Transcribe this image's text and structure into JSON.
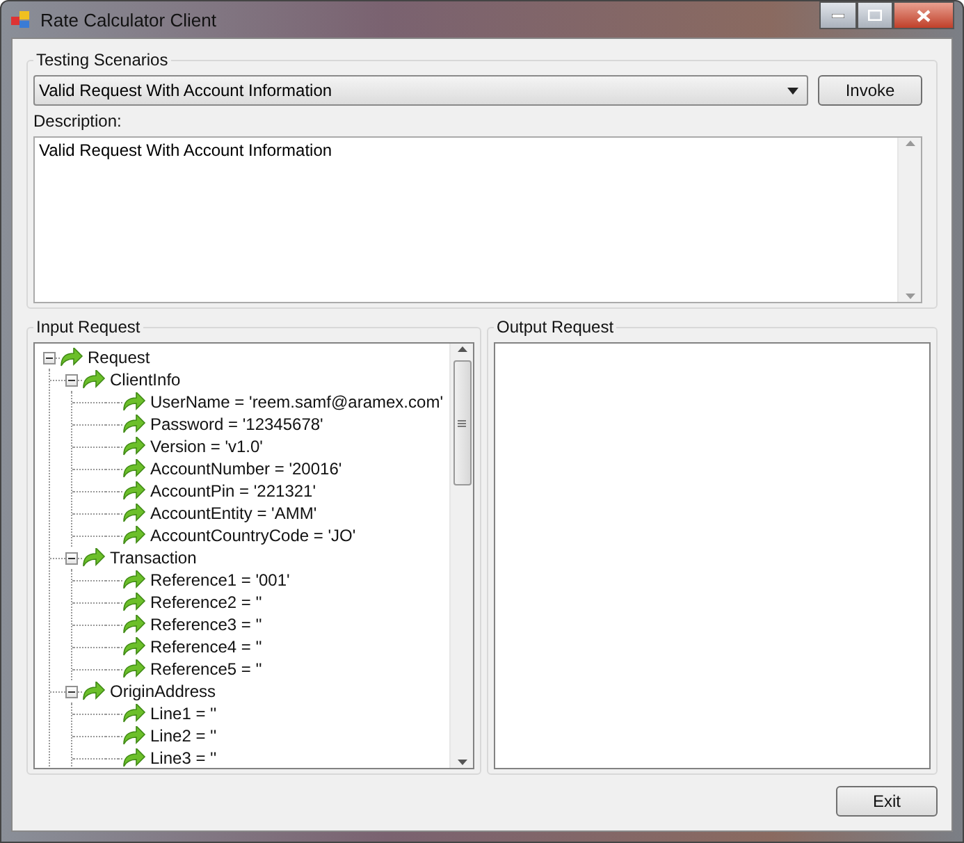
{
  "window": {
    "title": "Rate Calculator Client"
  },
  "scenarios": {
    "legend": "Testing Scenarios",
    "selected_value": "Valid Request With Account Information",
    "invoke_button": "Invoke",
    "description_label": "Description:",
    "description": "Valid Request With Account Information"
  },
  "input_request": {
    "legend": "Input Request",
    "tree": [
      {
        "label": "Request",
        "expanded": true,
        "children": [
          {
            "label": "ClientInfo",
            "expanded": true,
            "children": [
              {
                "label": "UserName = 'reem.samf@aramex.com'"
              },
              {
                "label": "Password = '12345678'"
              },
              {
                "label": "Version = 'v1.0'"
              },
              {
                "label": "AccountNumber = '20016'"
              },
              {
                "label": "AccountPin = '221321'"
              },
              {
                "label": "AccountEntity = 'AMM'"
              },
              {
                "label": "AccountCountryCode = 'JO'"
              }
            ]
          },
          {
            "label": "Transaction",
            "expanded": true,
            "children": [
              {
                "label": "Reference1 = '001'"
              },
              {
                "label": "Reference2 = ''"
              },
              {
                "label": "Reference3 = ''"
              },
              {
                "label": "Reference4 = ''"
              },
              {
                "label": "Reference5 = ''"
              }
            ]
          },
          {
            "label": "OriginAddress",
            "expanded": true,
            "children": [
              {
                "label": "Line1 = ''"
              },
              {
                "label": "Line2 = ''"
              },
              {
                "label": "Line3 = ''"
              }
            ]
          }
        ]
      }
    ]
  },
  "output_request": {
    "legend": "Output Request"
  },
  "exit_button": "Exit"
}
